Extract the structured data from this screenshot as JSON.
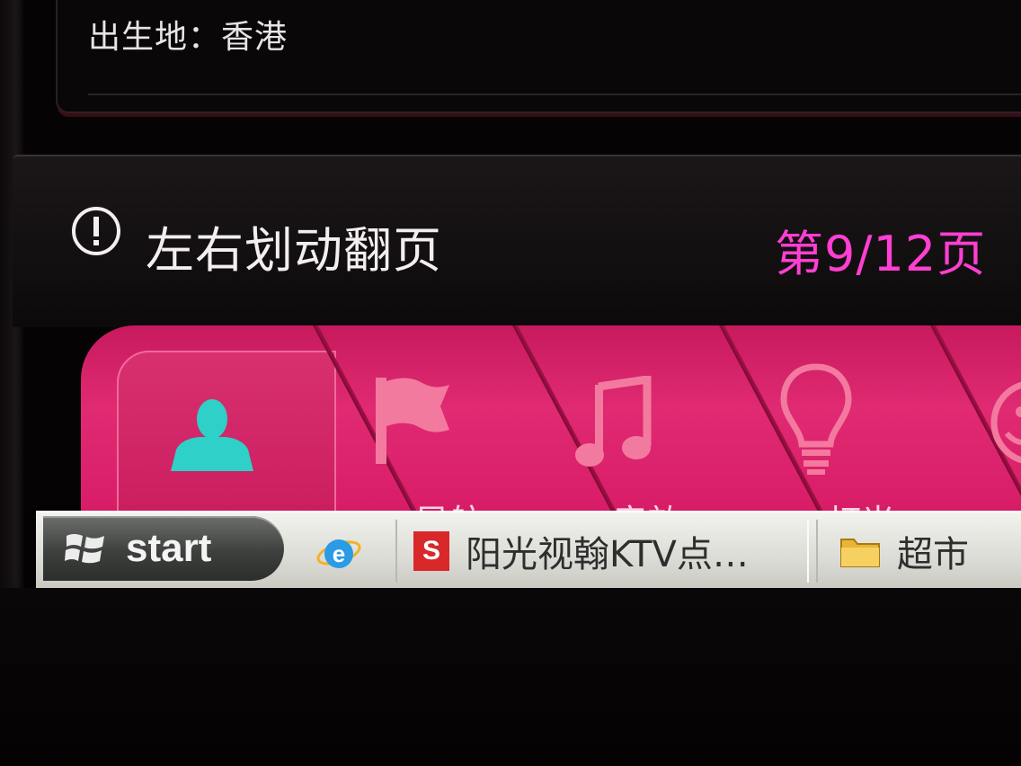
{
  "info": {
    "birthplace": "出生地：香港"
  },
  "hint": {
    "text": "左右划动翻页",
    "page": "第9/12页"
  },
  "carousel": {
    "tiles": [
      {
        "icon": "user-icon",
        "label": ""
      },
      {
        "icon": "flag-icon",
        "label": "导航"
      },
      {
        "icon": "music-note-icon",
        "label": "音效"
      },
      {
        "icon": "lightbulb-icon",
        "label": "灯光"
      },
      {
        "icon": "smiley-icon",
        "label": ""
      }
    ]
  },
  "taskbar": {
    "start_label": "start",
    "ktv_task": "阳光视翰KTV点…",
    "ktv_icon_letter": "S",
    "folder_task": "超市"
  },
  "colors": {
    "accent_pink": "#e02a72",
    "page_indicator": "#ff3fd2",
    "user_icon": "#2fd0c8"
  }
}
